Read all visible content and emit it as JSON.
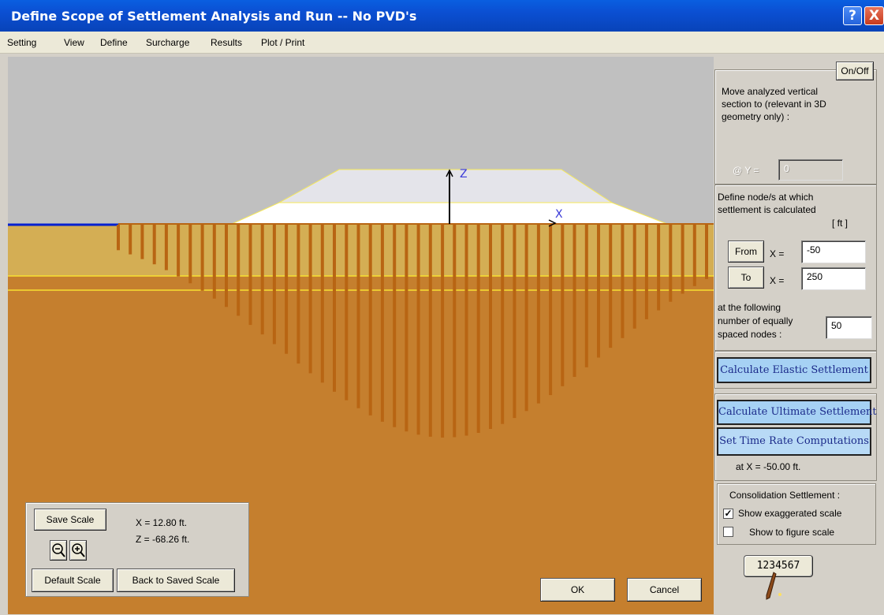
{
  "window": {
    "title": "Define Scope of Settlement Analysis and Run -- No PVD's",
    "help_glyph": "?",
    "close_glyph": "X"
  },
  "menu": [
    "Setting",
    "View",
    "Define",
    "Surcharge",
    "Results",
    "Plot / Print"
  ],
  "canvas": {
    "z_axis_label": "Z",
    "x_axis_label": "X",
    "colors": {
      "sky": "#c0c0c0",
      "upper_soil": "#d4ae54",
      "lower_soil": "#c57f2e",
      "settlement_bars": "#b86513",
      "embankment_top": "#e4e4ea",
      "embankment_bottom": "#ffffff",
      "ground_line": "#0020d0",
      "layer_lines": "#f8e030"
    }
  },
  "scale_panel": {
    "save_scale": "Save Scale",
    "zoom_out_icon": "zoom-out",
    "zoom_in_icon": "zoom-in",
    "default_scale": "Default Scale",
    "back_to_saved": "Back to Saved Scale",
    "x_readout": "X = 12.80 ft.",
    "z_readout": "Z = -68.26 ft."
  },
  "dialog_buttons": {
    "ok": "OK",
    "cancel": "Cancel"
  },
  "side": {
    "on_off": "On/Off",
    "move_section_text": [
      "Move analyzed vertical",
      "section to (relevant in 3D",
      "geometry only) :"
    ],
    "at_y_label": "@ Y =",
    "at_y_value": "0",
    "define_nodes_text": [
      "Define node/s at which",
      "settlement is calculated"
    ],
    "unit_label": "[ ft ]",
    "from_button": "From",
    "from_x_label": "X =",
    "from_value": "-50",
    "to_button": "To",
    "to_x_label": "X =",
    "to_value": "250",
    "nodes_text": [
      "at the following",
      "number of equally",
      "spaced nodes :"
    ],
    "nodes_value": "50",
    "calc_elastic": "Calculate  Elastic  Settlement",
    "calc_ultimate": "Calculate  Ultimate  Settlement",
    "set_time_rate": "Set  Time  Rate  Computations",
    "at_x_text": "at  X = -50.00 ft.",
    "consolidation_title": "Consolidation Settlement :",
    "show_exaggerated": "Show exaggerated scale",
    "show_exaggerated_checked": true,
    "show_figure_scale": "Show to figure scale",
    "show_figure_scale_checked": false,
    "counter_label": "1234567"
  }
}
